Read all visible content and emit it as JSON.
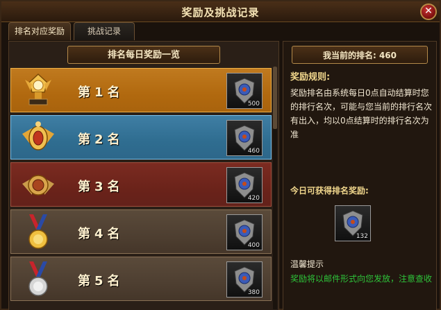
{
  "window": {
    "title": "奖励及挑战记录",
    "close_icon": "close-icon"
  },
  "tabs": [
    {
      "label": "排名对应奖励",
      "active": true
    },
    {
      "label": "挑战记录",
      "active": false
    }
  ],
  "left": {
    "banner": "排名每日奖励一览",
    "rows": [
      {
        "rank_label": "第1名",
        "badge_icon": "golden-trophy-icon",
        "reward_icon": "shield-emblem-icon",
        "reward_count": "500"
      },
      {
        "rank_label": "第2名",
        "badge_icon": "winged-gold-badge-icon",
        "reward_icon": "shield-emblem-icon",
        "reward_count": "460"
      },
      {
        "rank_label": "第3名",
        "badge_icon": "winged-bronze-badge-icon",
        "reward_icon": "shield-emblem-icon",
        "reward_count": "420"
      },
      {
        "rank_label": "第4名",
        "badge_icon": "gold-medal-icon",
        "reward_icon": "shield-emblem-icon",
        "reward_count": "400"
      },
      {
        "rank_label": "第5名",
        "badge_icon": "silver-medal-icon",
        "reward_icon": "shield-emblem-icon",
        "reward_count": "380"
      }
    ]
  },
  "right": {
    "current_rank_label": "我当前的排名: 460",
    "rules_title": "奖励规则:",
    "rules_body": "奖励排名由系统每日0点自动结算时您的排行名次，可能与您当前的排行名次有出入，均以0点结算时的排行名次为准",
    "today_title": "今日可获得排名奖励:",
    "today_reward_count": "132",
    "tip_title": "温馨提示",
    "tip_body": "奖励将以邮件形式向您发放，注意查收"
  },
  "colors": {
    "row1": "#b1690f",
    "row2": "#2f6d90",
    "row3": "#6b231a",
    "row4": "#4e3f31",
    "accent_gold": "#f0d68c",
    "tip_green": "#2ec43a"
  }
}
